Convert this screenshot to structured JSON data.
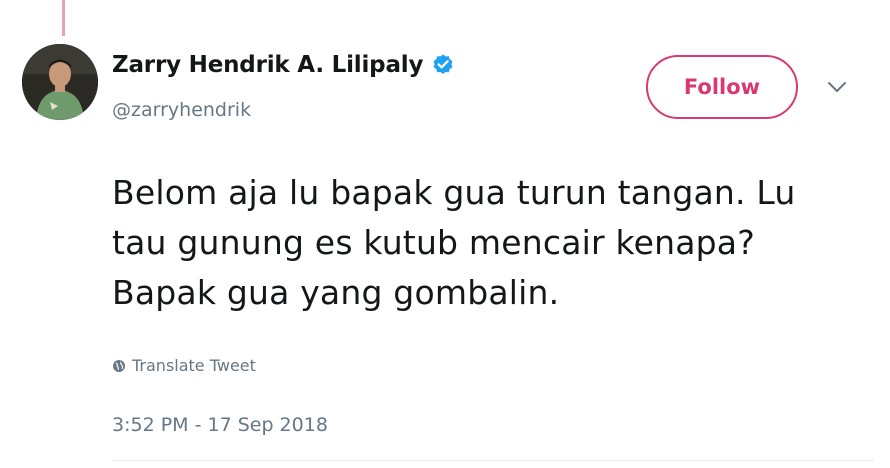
{
  "user": {
    "display_name": "Zarry Hendrik A. Lilipaly",
    "handle": "@zarryhendrik",
    "verified": true,
    "avatar_icon": "user-avatar-photo"
  },
  "actions": {
    "follow_label": "Follow",
    "more_icon": "chevron-down-icon"
  },
  "tweet": {
    "lines": [
      "Belom aja lu bapak gua turun tangan. Lu",
      "tau gunung es kutub mencair kenapa?",
      "Bapak gua yang gombalin."
    ],
    "translate_label": "Translate Tweet",
    "timestamp": "3:52 PM - 17 Sep 2018"
  },
  "colors": {
    "accent": "#d9396e",
    "verified_blue": "#1da1f2",
    "secondary_text": "#657786",
    "thread_line": "#e6a1bf"
  }
}
